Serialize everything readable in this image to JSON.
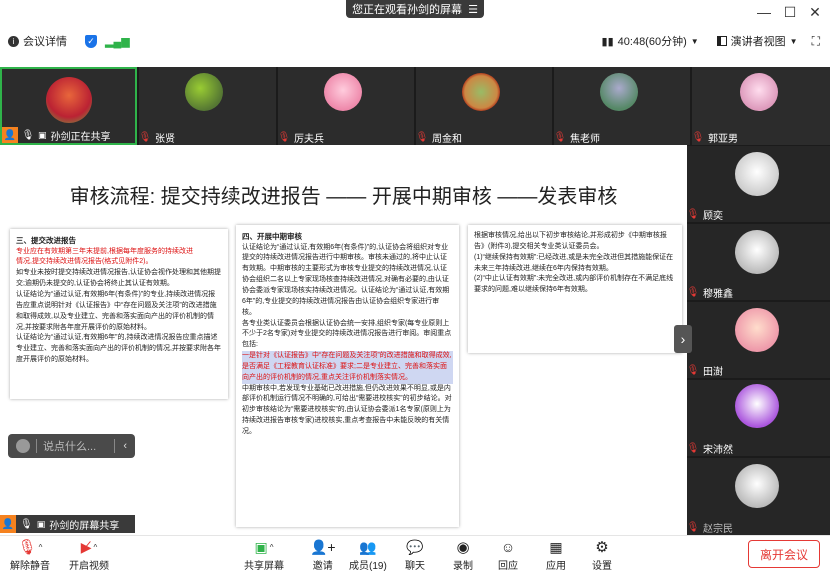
{
  "banner": {
    "text": "您正在观看孙剑的屏幕"
  },
  "window_controls": {
    "min": "—",
    "max": "☐",
    "close": "✕"
  },
  "meeting_bar": {
    "info_label": "会议详情",
    "timer": "40:48(60分钟)",
    "view_label": "演讲者视图"
  },
  "top_tiles": [
    {
      "name": "孙剑正在共享"
    },
    {
      "name": "张贤"
    },
    {
      "name": "厉夫兵"
    },
    {
      "name": "周金和"
    },
    {
      "name": "焦老师"
    },
    {
      "name": "郭亚男"
    }
  ],
  "right_tiles": [
    {
      "name": "顾奕"
    },
    {
      "name": "穆雅鑫"
    },
    {
      "name": "田澍"
    },
    {
      "name": "宋沛然"
    },
    {
      "name": "赵宗民"
    }
  ],
  "slide": {
    "title": "审核流程:  提交持续改进报告 —— 开展中期审核 ——发表审核"
  },
  "doc1": {
    "heading": "三、提交改进报告",
    "lines_red": [
      "专业应在有效期第三年末提前,根据每年度服务的持续改进",
      "情况,提交持续改进情况报告(格式见附件2)。"
    ],
    "lines": [
      "如专业未按时提交持续改进情况报告,认证协会视作处理和其他期提交;逾期仍未提交的,认证协会将终止其认证有效期。",
      "认证结论为“通过认证,有效期6年(有条件)”的专业,持续改进情况报告应重点说明针对《认证报告》中“存在问题及关注项”的改进措施和取得成效,以及专业建立、完善和落实面向产出的评价机制的情况,并按要求附各年度开展评价的原始材料。",
      "认证结论为“通过认证,有效期6年”的,持续改进情况报告应重点描述专业建立、完善和落实面向产出的评价机制的情况,并按要求附各年度开展评价的原始材料。"
    ]
  },
  "doc2": {
    "heading": "四、开展中期审核",
    "lines": [
      "认证结论为“通过认证,有效期6年(有条件)”的,认证协会将组织对专业提交的持续改进情况报告进行中期审核。审核未通过的,将中止认证有效期。中期审核的主要形式为审核专业提交的持续改进情况,认证协会组织二名以上专家现场核查持续改进情况,对确有必要的,由认证协会委派专家现场核实持续改进情况。认证结论为“通过认证,有效期6年”的,专业提交的持续改进情况报告由认证协会组织专家进行审核。",
      "各专业类认证委员会根据认证协会统一安排,组织专家(每专业原则上不少于2名专家)对专业提交的持续改进情况报告进行审阅。审阅重点包括:"
    ],
    "highlight": "一是针对《认证报告》中“存在问题及关注项”的改进措施和取得成效,是否满足《工程教育认证标准》要求;二是专业建立、完善和落实面向产出的评价机制的情况,重点关注评价机制落实情况。",
    "tail": "中期审核中,若发现专业基础已改进措施,但仍改进效果不明显,或是内部评价机制运行情况不明确的,可给出“需要进校核实”的初步结论。对初步审核结论为“需要进校核实”的,由认证协会委派1名专家(原则上为持续改进报告审核专家)进校核实,重点考查报告中未能反映的有关情况。"
  },
  "doc3": {
    "lines": [
      "根据审核情况,给出以下初步审核结论,并形成初步《中期审核报告》(附件3),提交相关专业类认证委员会。",
      "(1)“继续保持有效期”:已经改进,或是未完全改进但其措施能保证在未来三年持续改进,继续在6年内保持有效期。",
      "(2)“中止认证有效期”:未完全改进,或内部评价机制存在不满足底线要求的问题,难以继续保持6年有效期。"
    ]
  },
  "comment": {
    "placeholder": "说点什么..."
  },
  "bottom_share_label": "孙剑的屏幕共享",
  "toolbar": {
    "mute": "解除静音",
    "video": "开启视频",
    "share": "共享屏幕",
    "invite": "邀请",
    "members": "成员(19)",
    "chat": "聊天",
    "record": "录制",
    "reply": "回应",
    "apps": "应用",
    "settings": "设置",
    "leave": "离开会议"
  },
  "colors": {
    "active": "#2fb34a",
    "danger": "#e53935",
    "accent": "#1a73e8"
  }
}
